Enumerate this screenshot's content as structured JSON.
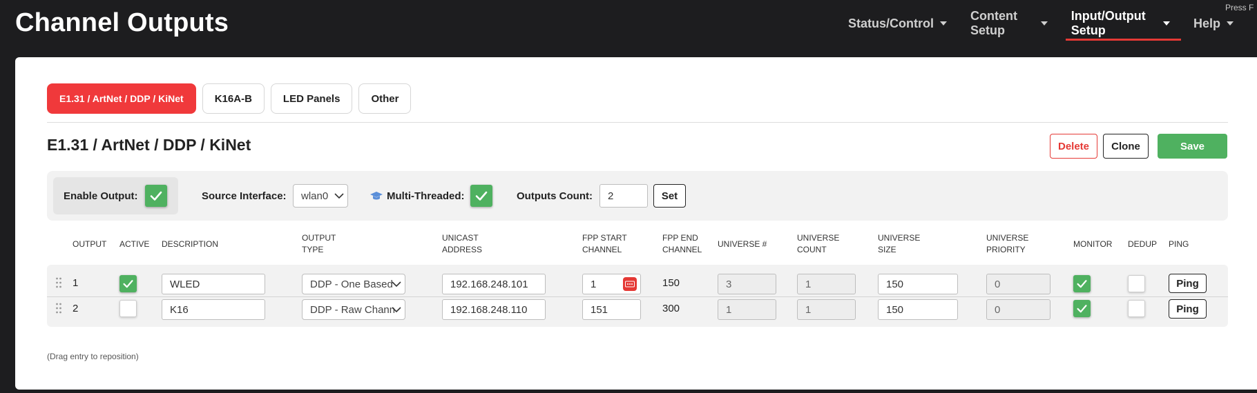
{
  "header": {
    "title": "Channel Outputs",
    "press_hint": "Press F",
    "nav": [
      {
        "label": "Status/Control"
      },
      {
        "label": "Content Setup"
      },
      {
        "label": "Input/Output Setup"
      },
      {
        "label": "Help"
      }
    ]
  },
  "tabs": [
    {
      "label": "E1.31 / ArtNet / DDP / KiNet"
    },
    {
      "label": "K16A-B"
    },
    {
      "label": "LED Panels"
    },
    {
      "label": "Other"
    }
  ],
  "section": {
    "title": "E1.31 / ArtNet / DDP / KiNet",
    "delete_label": "Delete",
    "clone_label": "Clone",
    "save_label": "Save"
  },
  "settings": {
    "enable_output_label": "Enable Output:",
    "enable_output_checked": true,
    "source_interface_label": "Source Interface:",
    "source_interface_value": "wlan0",
    "multithreaded_label": "Multi-Threaded:",
    "multithreaded_checked": true,
    "outputs_count_label": "Outputs Count:",
    "outputs_count_value": "2",
    "set_label": "Set"
  },
  "table": {
    "headers": {
      "output": "OUTPUT",
      "active": "ACTIVE",
      "description": "DESCRIPTION",
      "output_type_1": "OUTPUT",
      "output_type_2": "TYPE",
      "unicast_1": "UNICAST",
      "unicast_2": "ADDRESS",
      "fpp_start_1": "FPP START",
      "fpp_start_2": "CHANNEL",
      "fpp_end_1": "FPP END",
      "fpp_end_2": "CHANNEL",
      "universe": "UNIVERSE #",
      "universe_count_1": "UNIVERSE",
      "universe_count_2": "COUNT",
      "universe_size_1": "UNIVERSE",
      "universe_size_2": "SIZE",
      "universe_priority_1": "UNIVERSE",
      "universe_priority_2": "PRIORITY",
      "monitor": "MONITOR",
      "dedup": "DEDUP",
      "ping": "PING"
    },
    "rows": [
      {
        "output": "1",
        "active": true,
        "description": "WLED",
        "output_type": "DDP - One Based",
        "unicast_address": "192.168.248.101",
        "fpp_start_channel": "1",
        "fpp_end_channel": "150",
        "universe": "3",
        "universe_count": "1",
        "universe_size": "150",
        "universe_priority": "0",
        "monitor": true,
        "dedup": false,
        "ping_label": "Ping"
      },
      {
        "output": "2",
        "active": false,
        "description": "K16",
        "output_type": "DDP - Raw Channel",
        "unicast_address": "192.168.248.110",
        "fpp_start_channel": "151",
        "fpp_end_channel": "300",
        "universe": "1",
        "universe_count": "1",
        "universe_size": "150",
        "universe_priority": "0",
        "monitor": true,
        "dedup": false,
        "ping_label": "Ping"
      }
    ]
  },
  "hint": "(Drag entry to reposition)",
  "colors": {
    "accent_red": "#f0393b",
    "check_green": "#4fb160",
    "header_bg": "#1d1d1f"
  }
}
